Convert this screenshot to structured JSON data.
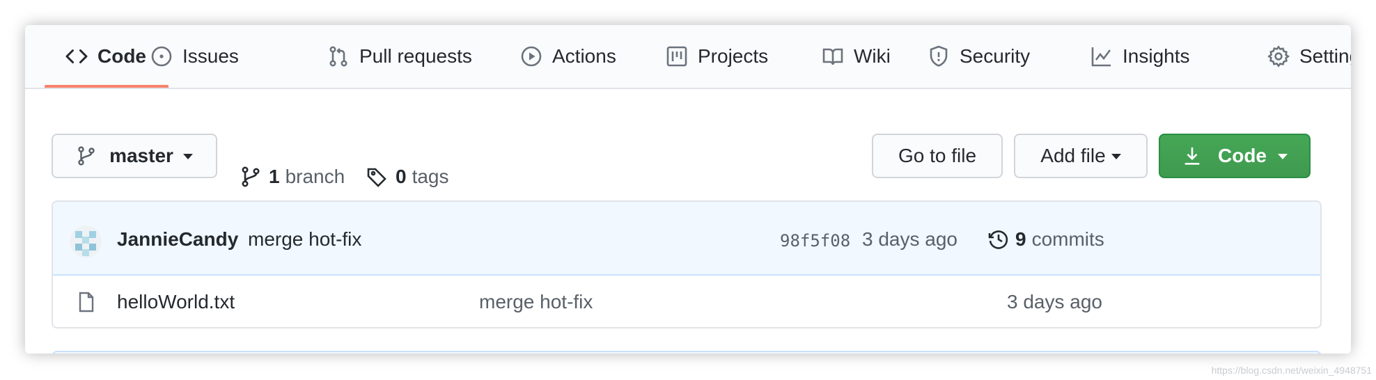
{
  "tabs": [
    {
      "label": "Code",
      "icon": "code-icon",
      "active": true
    },
    {
      "label": "Issues",
      "icon": "issue-opened-icon"
    },
    {
      "label": "Pull requests",
      "icon": "git-pull-request-icon"
    },
    {
      "label": "Actions",
      "icon": "play-icon"
    },
    {
      "label": "Projects",
      "icon": "project-icon"
    },
    {
      "label": "Wiki",
      "icon": "book-icon"
    },
    {
      "label": "Security",
      "icon": "shield-icon"
    },
    {
      "label": "Insights",
      "icon": "graph-icon"
    },
    {
      "label": "Settings",
      "icon": "gear-icon"
    }
  ],
  "branch_selector": {
    "label": "master",
    "icon": "git-branch-icon"
  },
  "branches": {
    "count": "1",
    "label": "branch"
  },
  "tags": {
    "count": "0",
    "label": "tags"
  },
  "buttons": {
    "go_to_file": "Go to file",
    "add_file": "Add file",
    "code": "Code"
  },
  "latest_commit": {
    "author": "JannieCandy",
    "message": "merge hot-fix",
    "sha": "98f5f08",
    "time": "3 days ago",
    "commits_count": "9",
    "commits_label": "commits"
  },
  "files": [
    {
      "name": "helloWorld.txt",
      "message": "merge hot-fix",
      "time": "3 days ago",
      "icon": "file-icon"
    }
  ],
  "watermark": "https://blog.csdn.net/weixin_4948751",
  "colors": {
    "accent_underline": "#f9826c",
    "green_button": "#2ea44f",
    "commit_bg": "#f1f8ff"
  }
}
